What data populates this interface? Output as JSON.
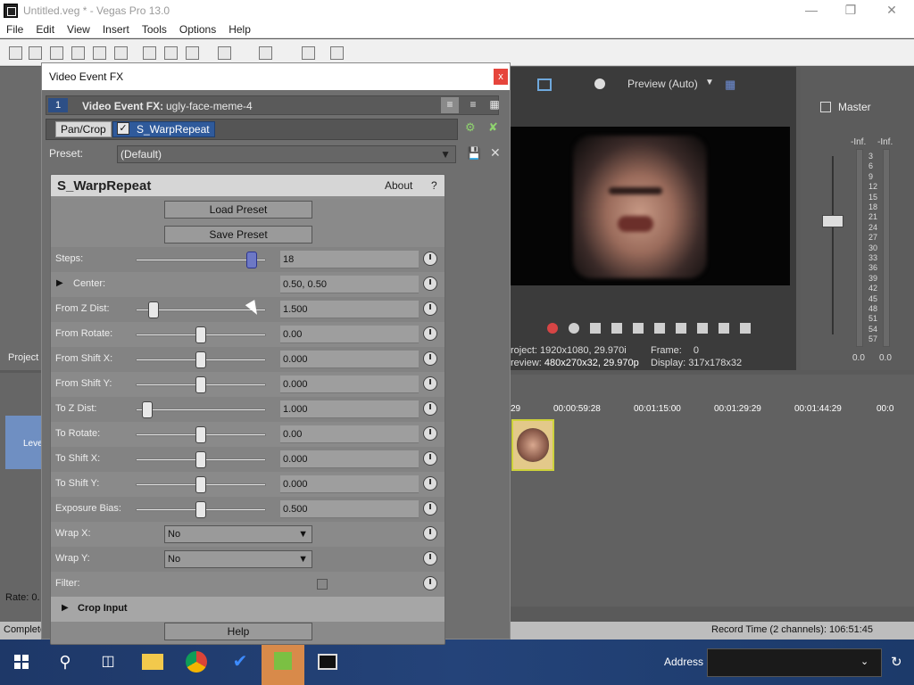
{
  "window": {
    "title": "Untitled.veg * - Vegas Pro 13.0"
  },
  "menu": [
    "File",
    "Edit",
    "View",
    "Insert",
    "Tools",
    "Options",
    "Help"
  ],
  "preview": {
    "mode_label": "Preview (Auto)",
    "project_label": "roject:",
    "project_value": "1920x1080, 29.970i",
    "preview_label": "review:",
    "preview_value": "480x270x32, 29.970p",
    "frame_label": "Frame:",
    "frame_value": "0",
    "display_label": "Display:",
    "display_value": "317x178x32"
  },
  "master": {
    "title": "Master",
    "left_inf": "-Inf.",
    "right_inf": "-Inf.",
    "left_val": "0.0",
    "right_val": "0.0",
    "scale": [
      "3",
      "6",
      "9",
      "12",
      "15",
      "18",
      "21",
      "24",
      "27",
      "30",
      "33",
      "36",
      "39",
      "42",
      "45",
      "48",
      "51",
      "54",
      "57"
    ]
  },
  "timeline": {
    "ruler": [
      "29",
      "00:00:59:28",
      "00:01:15:00",
      "00:01:29:29",
      "00:01:44:29",
      "00:0"
    ]
  },
  "left_panel": {
    "project_tab": "Project",
    "level_label": "Leve",
    "rate_label": "Rate: 0.",
    "complete_label": "Complete"
  },
  "status": {
    "record_time": "Record Time (2 channels): 106:51:45"
  },
  "taskbar": {
    "address_label": "Address"
  },
  "fx": {
    "title": "Video Event FX",
    "close": "x",
    "event_num": "1",
    "event_label": "Video Event FX:",
    "event_name": "ugly-face-meme-4",
    "chain": {
      "pan_crop": "Pan/Crop",
      "warp": "S_WarpRepeat"
    },
    "preset_label": "Preset:",
    "preset_value": "(Default)",
    "plugin_name": "S_WarpRepeat",
    "about": "About",
    "help_q": "?",
    "load_preset": "Load Preset",
    "save_preset": "Save Preset",
    "params": [
      {
        "label": "Steps:",
        "value": "18",
        "pos": 0.89
      },
      {
        "label": "Center:",
        "value": "0.50, 0.50"
      },
      {
        "label": "From Z Dist:",
        "value": "1.500",
        "pos": 0.14
      },
      {
        "label": "From Rotate:",
        "value": "0.00",
        "pos": 0.5
      },
      {
        "label": "From Shift X:",
        "value": "0.000",
        "pos": 0.5
      },
      {
        "label": "From Shift Y:",
        "value": "0.000",
        "pos": 0.5
      },
      {
        "label": "To Z Dist:",
        "value": "1.000",
        "pos": 0.09
      },
      {
        "label": "To Rotate:",
        "value": "0.00",
        "pos": 0.5
      },
      {
        "label": "To Shift X:",
        "value": "0.000",
        "pos": 0.5
      },
      {
        "label": "To Shift Y:",
        "value": "0.000",
        "pos": 0.5
      },
      {
        "label": "Exposure Bias:",
        "value": "0.500",
        "pos": 0.5
      },
      {
        "label": "Wrap X:",
        "value": "No"
      },
      {
        "label": "Wrap Y:",
        "value": "No"
      },
      {
        "label": "Filter:"
      }
    ],
    "crop_input": "Crop Input",
    "help": "Help"
  }
}
